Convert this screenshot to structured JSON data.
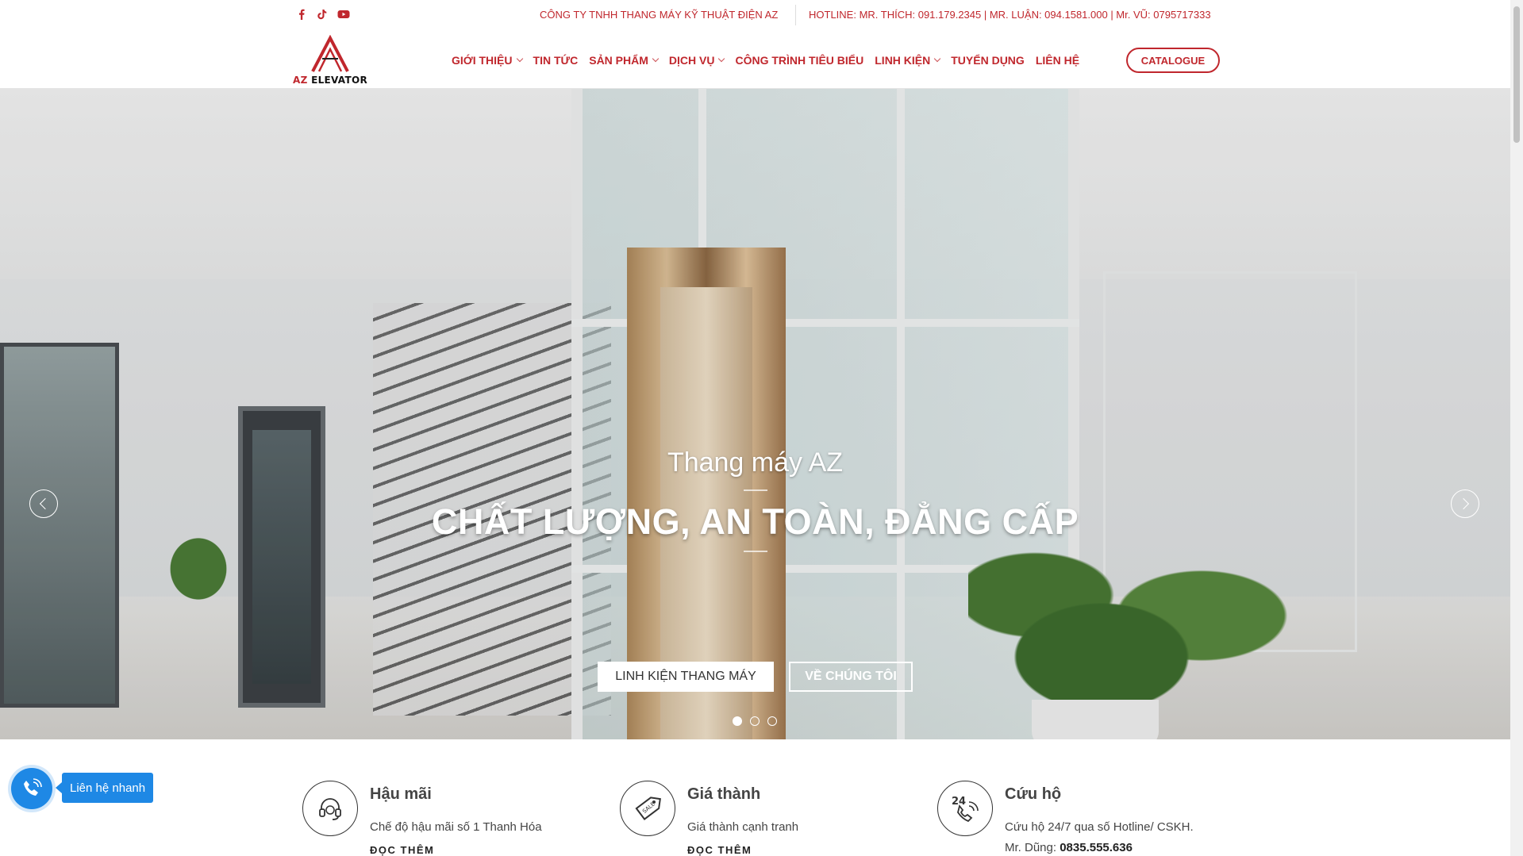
{
  "topbar": {
    "social": [
      "facebook-icon",
      "tiktok-icon",
      "youtube-icon"
    ],
    "company": "CÔNG TY TNHH THANG MÁY KỸ THUẬT ĐIỆN AZ",
    "hotline": "HOTLINE: MR. THÍCH: 091.179.2345 | MR. LUẬN: 094.1581.000 | Mr. VŨ: 0795717333"
  },
  "header": {
    "logo_text_az": "AZ",
    "logo_text_rest": " ELEVATOR",
    "nav": [
      {
        "label": "GIỚI THIỆU",
        "dropdown": true
      },
      {
        "label": "TIN TỨC",
        "dropdown": false
      },
      {
        "label": "SẢN PHẨM",
        "dropdown": true
      },
      {
        "label": "DỊCH VỤ",
        "dropdown": true
      },
      {
        "label": "CÔNG TRÌNH TIÊU BIỂU",
        "dropdown": false
      },
      {
        "label": "LINH KIỆN",
        "dropdown": true
      },
      {
        "label": "TUYỂN DỤNG",
        "dropdown": false
      },
      {
        "label": "LIÊN HỆ",
        "dropdown": false
      }
    ],
    "catalogue": "CATALOGUE"
  },
  "hero": {
    "subtitle": "Thang máy AZ",
    "title": "CHẤT LƯỢNG, AN TOÀN, ĐẲNG CẤP",
    "btn_primary": "LINH KIỆN THANG MÁY",
    "btn_secondary": "VỀ CHÚNG TÔI",
    "slides": 3,
    "active_slide": 1
  },
  "features": [
    {
      "title": "Hậu mãi",
      "text": "Chế độ hậu mãi số 1 Thanh Hóa",
      "more": "ĐỌC THÊM",
      "icon": "headset-icon"
    },
    {
      "title": "Giá thành",
      "text": "Giá thành cạnh tranh",
      "more": "ĐỌC THÊM",
      "icon": "sale-tag-icon"
    },
    {
      "title": "Cứu hộ",
      "text": "Cứu hộ 24/7 qua số Hotline/ CSKH.",
      "text2_prefix": "Mr. Dũng: ",
      "text2_phone": "0835.555.636",
      "icon": "phone-24-icon"
    }
  ],
  "quick_contact": {
    "label": "Liên hệ nhanh",
    "icon": "phone-icon"
  },
  "colors": {
    "brand": "#c0272d",
    "contact": "#1e88e5"
  }
}
